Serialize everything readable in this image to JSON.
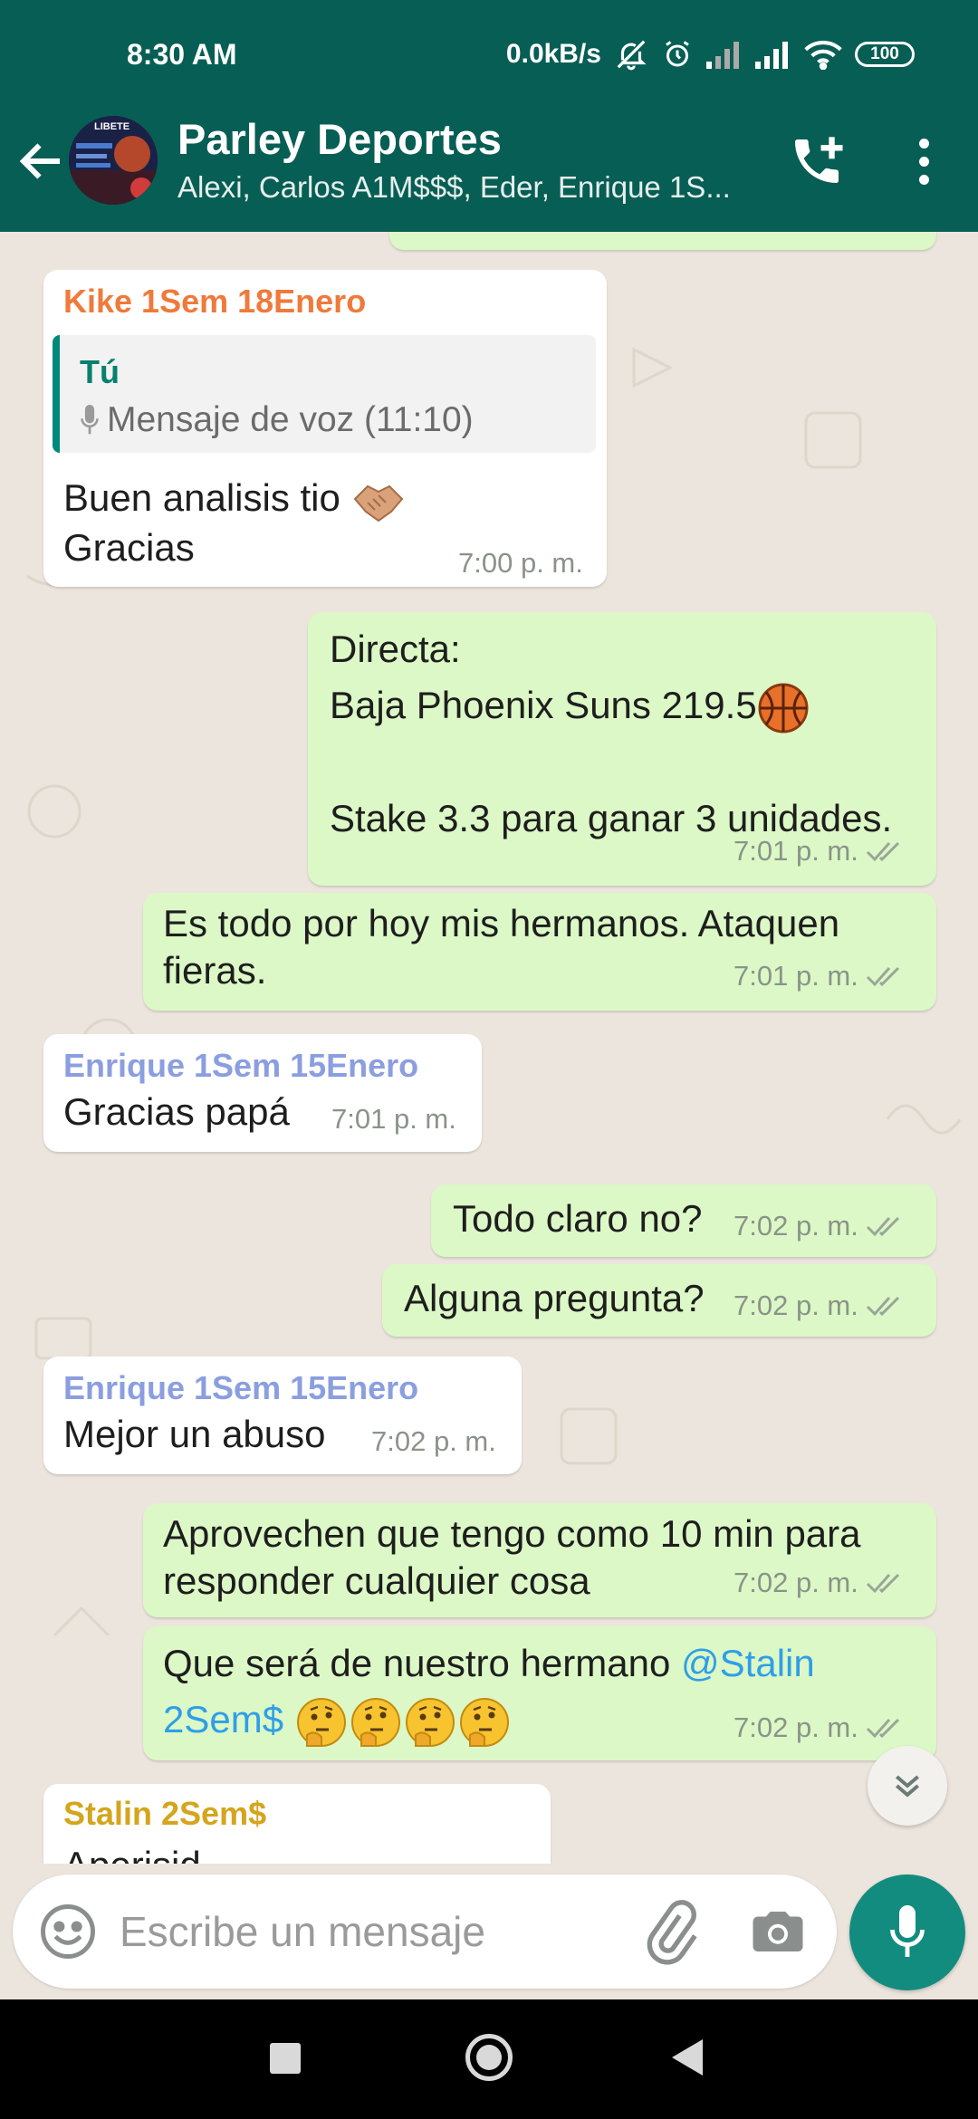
{
  "status_bar": {
    "time": "8:30 AM",
    "net_speed": "0.0kB/s",
    "battery": "100"
  },
  "header": {
    "title": "Parley Deportes",
    "members": "Alexi, Carlos A1M$$$, Eder, Enrique 1S...",
    "avatar_label": "LIBETE",
    "colors": {
      "primary": "#075e54"
    }
  },
  "messages": [
    {
      "type": "in",
      "sender": "Kike 1Sem 18Enero",
      "sender_color": "#ef7a3b",
      "quote": {
        "author": "Tú",
        "text": "Mensaje de voz (11:10)"
      },
      "lines": [
        "Buen analisis tio",
        "Gracias"
      ],
      "emoji": "handshake",
      "time": "7:00 p. m."
    },
    {
      "type": "out",
      "lines": [
        "Directa:",
        "Baja Phoenix Suns 219.5",
        "Stake 3.3 para ganar 3 unidades."
      ],
      "emoji": "basketball",
      "time": "7:01 p. m."
    },
    {
      "type": "out",
      "lines": [
        "Es todo por hoy mis hermanos. Ataquen",
        "fieras."
      ],
      "time": "7:01 p. m."
    },
    {
      "type": "in",
      "sender": "Enrique 1Sem 15Enero",
      "sender_color": "#8b9ee0",
      "lines": [
        "Gracias papá"
      ],
      "time": "7:01 p. m."
    },
    {
      "type": "out",
      "lines": [
        "Todo claro no?"
      ],
      "time": "7:02 p. m."
    },
    {
      "type": "out",
      "lines": [
        "Alguna pregunta?"
      ],
      "time": "7:02 p. m."
    },
    {
      "type": "in",
      "sender": "Enrique 1Sem 15Enero",
      "sender_color": "#8b9ee0",
      "lines": [
        "Mejor un abuso"
      ],
      "time": "7:02 p. m."
    },
    {
      "type": "out",
      "lines": [
        "Aprovechen que tengo como 10 min para",
        "responder cualquier cosa"
      ],
      "time": "7:02 p. m."
    },
    {
      "type": "out",
      "lines": [
        "Que será de nuestro hermano "
      ],
      "mention_a": "@Stalin",
      "mention_b": "2Sem$",
      "emoji": "thinking-face x4",
      "time": "7:02 p. m."
    },
    {
      "type": "in",
      "sender": "Stalin 2Sem$",
      "sender_color": "#d4a51d",
      "lines": [
        "Aperisid..."
      ]
    }
  ],
  "composer": {
    "placeholder": "Escribe un mensaje"
  }
}
